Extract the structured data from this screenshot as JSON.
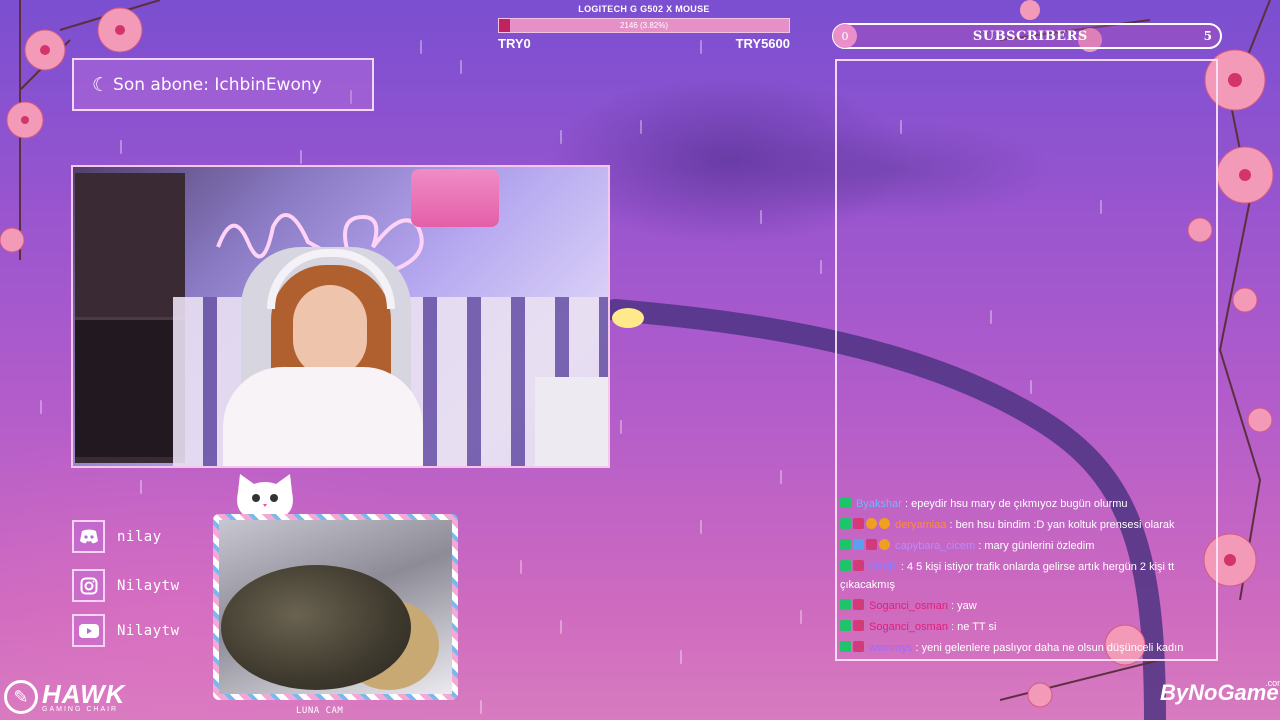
{
  "goal": {
    "title": "LOGITECH G G502 X MOUSE",
    "progress_text": "2146 (3.82%)",
    "progress_fraction": 0.0382,
    "min_label": "TRY0",
    "max_label": "TRY5600",
    "fill_color": "#c0235f"
  },
  "last_sub": {
    "text": "Son abone: IchbinEwony",
    "icon": "crescent-moon-icon"
  },
  "socials": [
    {
      "icon": "discord-icon",
      "label": "nilay"
    },
    {
      "icon": "instagram-icon",
      "label": "Nilaytw"
    },
    {
      "icon": "youtube-icon",
      "label": "Nilaytw"
    }
  ],
  "catcam": {
    "label": "LUNA CAM"
  },
  "subscribers": {
    "label": "SUBSCRIBERS",
    "start": "0",
    "end": "5"
  },
  "chat": [
    {
      "badges": [
        "green"
      ],
      "user": "Byakshar",
      "color": "#6fb8ff",
      "message": ": epeydir hsu mary de çıkmıyoz bugün olurmu"
    },
    {
      "badges": [
        "green",
        "sub",
        "orange",
        "orange"
      ],
      "user": "deryamiaa",
      "color": "#ff8a3c",
      "message": ": ben hsu bindim :D yan koltuk prensesi olarak"
    },
    {
      "badges": [
        "green",
        "blue",
        "sub",
        "orange"
      ],
      "user": "capybara_cicem",
      "color": "#b58cff",
      "message": ": mary günlerini özledim"
    },
    {
      "badges": [
        "green",
        "sub"
      ],
      "user": "nizqi1",
      "color": "#8a7bff",
      "message": ": 4 5 kişi istiyor trafik onlarda gelirse artık hergün 2 kişi tt çıkacakmış"
    },
    {
      "badges": [
        "green",
        "sub"
      ],
      "user": "Soganci_osman",
      "color": "#e0207a",
      "message": ": yaw"
    },
    {
      "badges": [
        "green",
        "sub"
      ],
      "user": "Soganci_osman",
      "color": "#e0207a",
      "message": ": ne TT si"
    },
    {
      "badges": [
        "green",
        "sub"
      ],
      "user": "wommys",
      "color": "#9b6bff",
      "message": ": yeni gelenlere paslıyor daha ne olsun düşünceli kadın"
    }
  ],
  "logos": {
    "hawk_name": "HAWK",
    "hawk_sub": "GAMING CHAIR",
    "bynogame": "ByNoGame",
    "bynogame_suffix": ".com"
  }
}
